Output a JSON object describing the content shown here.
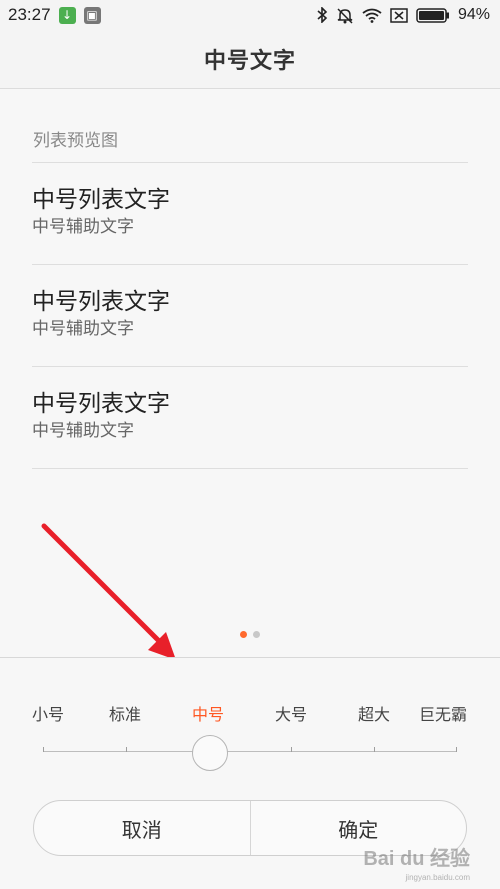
{
  "status_bar": {
    "time": "23:27",
    "battery_percent": "94%",
    "icons": [
      "download-notification-icon",
      "app-notification-icon",
      "bluetooth-icon",
      "mute-icon",
      "wifi-icon",
      "no-sim-icon",
      "battery-icon"
    ]
  },
  "header": {
    "title": "中号文字"
  },
  "preview": {
    "section_title": "列表预览图",
    "items": [
      {
        "primary": "中号列表文字",
        "secondary": "中号辅助文字"
      },
      {
        "primary": "中号列表文字",
        "secondary": "中号辅助文字"
      },
      {
        "primary": "中号列表文字",
        "secondary": "中号辅助文字"
      }
    ],
    "page_indicator": {
      "pages": 2,
      "current": 1
    }
  },
  "font_size_selector": {
    "options": [
      "小号",
      "标准",
      "中号",
      "大号",
      "超大",
      "巨无霸"
    ],
    "selected_index": 2
  },
  "actions": {
    "cancel_label": "取消",
    "confirm_label": "确定"
  },
  "watermark": {
    "text": "Bai du 经验",
    "subtext": "jingyan.baidu.com"
  },
  "colors": {
    "accent": "#ff5722",
    "annotation_arrow": "#e8202a",
    "background": "#f7f7f7"
  }
}
